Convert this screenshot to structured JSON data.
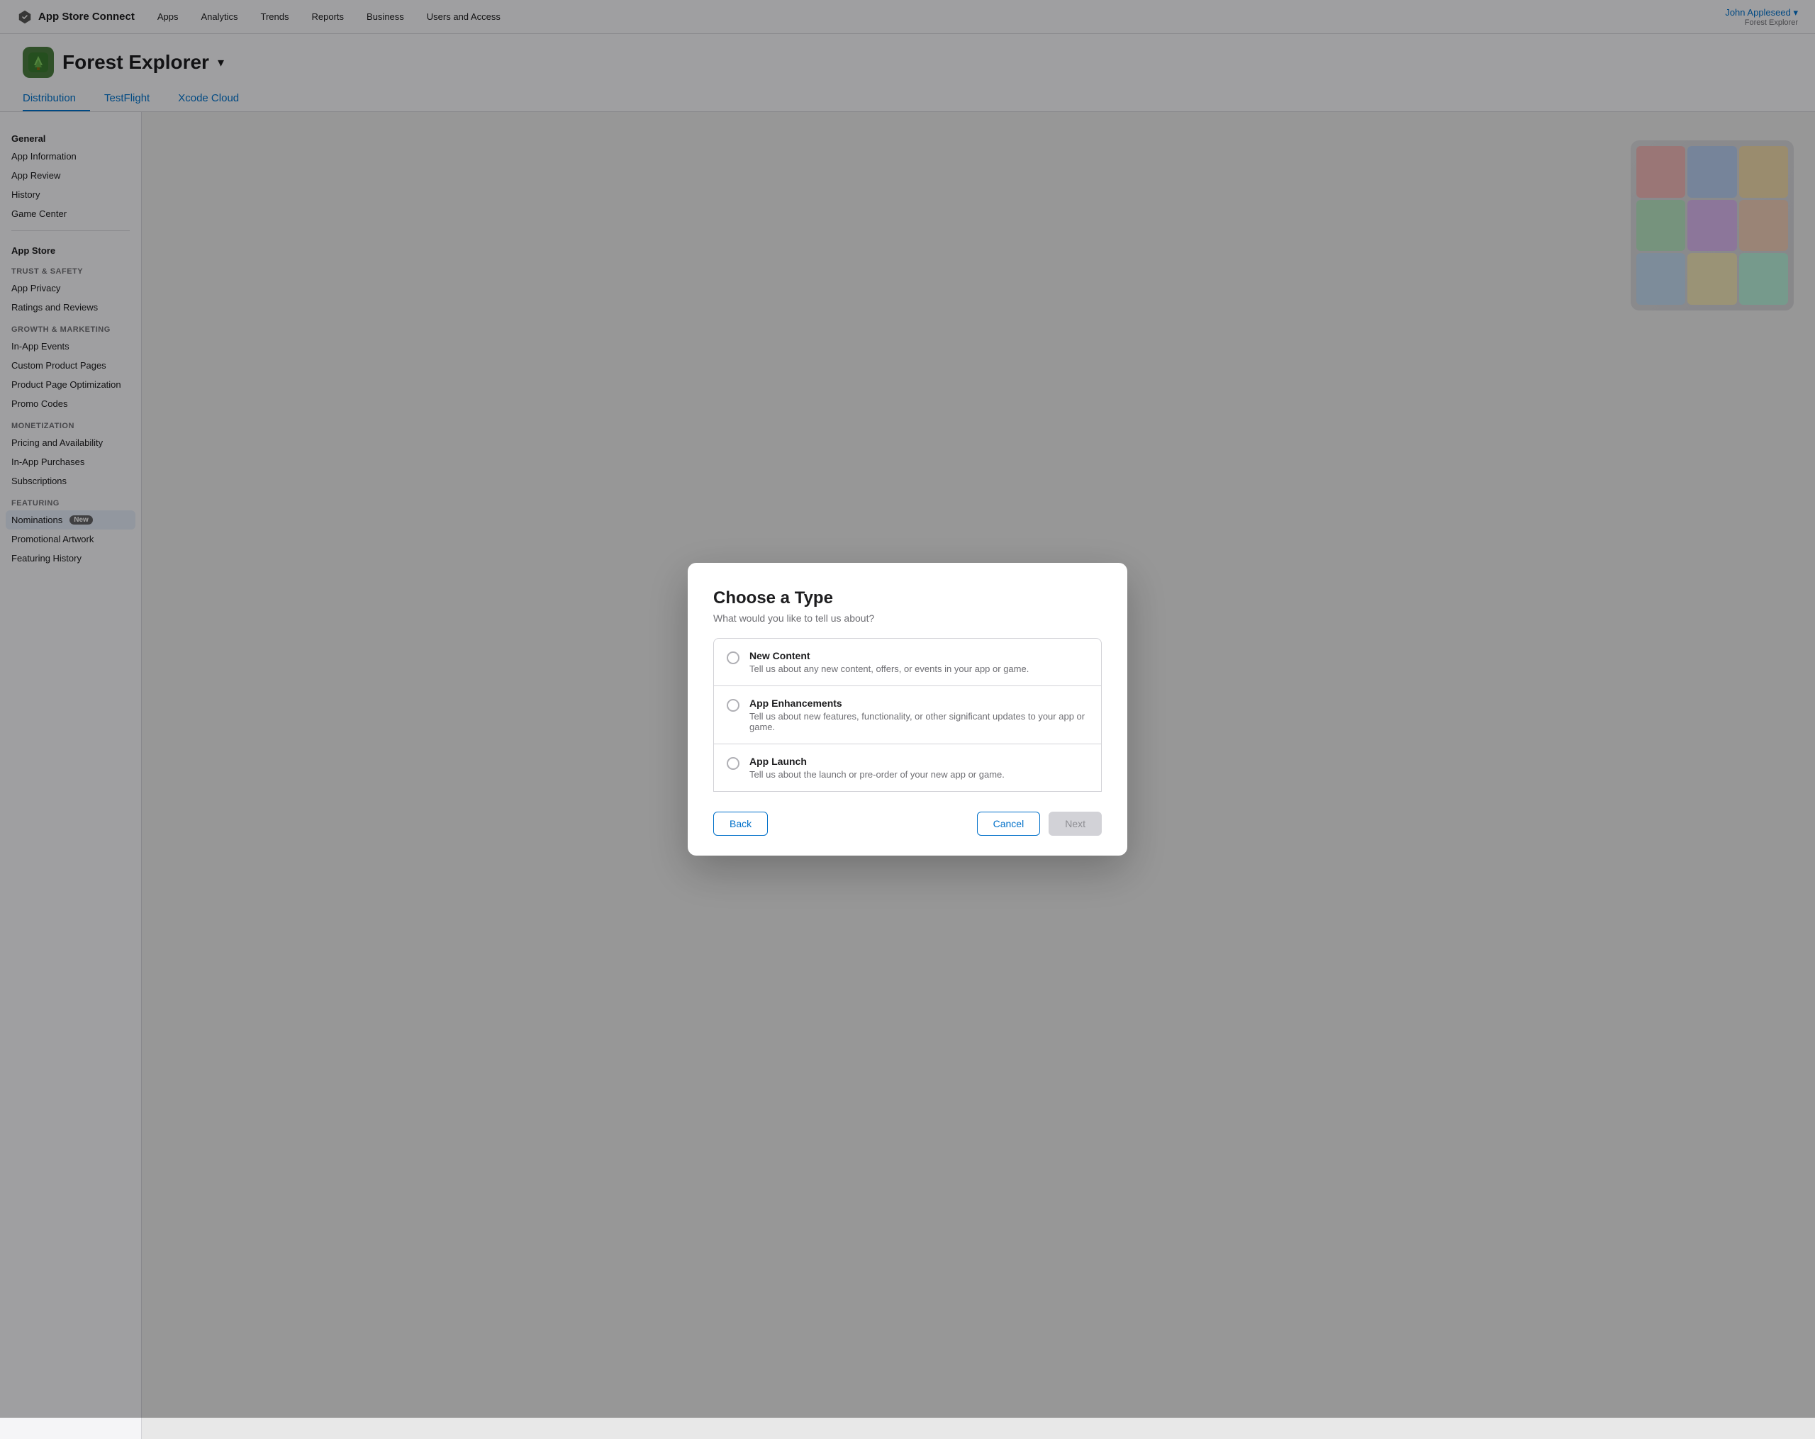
{
  "topnav": {
    "logo_icon": "⚡",
    "brand": "App Store Connect",
    "links": [
      "Apps",
      "Analytics",
      "Trends",
      "Reports",
      "Business",
      "Users and Access"
    ],
    "user_name": "John Appleseed ▾",
    "user_app": "Forest Explorer"
  },
  "app_header": {
    "app_name": "Forest Explorer",
    "dropdown_char": "▾",
    "tabs": [
      {
        "label": "Distribution",
        "active": true
      },
      {
        "label": "TestFlight",
        "active": false
      },
      {
        "label": "Xcode Cloud",
        "active": false
      }
    ]
  },
  "sidebar": {
    "general_title": "General",
    "general_items": [
      {
        "label": "App Information"
      },
      {
        "label": "App Review"
      },
      {
        "label": "History"
      },
      {
        "label": "Game Center"
      }
    ],
    "appstore_title": "App Store",
    "trust_safety_title": "TRUST & SAFETY",
    "trust_items": [
      {
        "label": "App Privacy"
      },
      {
        "label": "Ratings and Reviews"
      }
    ],
    "growth_title": "GROWTH & MARKETING",
    "growth_items": [
      {
        "label": "In-App Events"
      },
      {
        "label": "Custom Product Pages"
      },
      {
        "label": "Product Page Optimization"
      },
      {
        "label": "Promo Codes"
      }
    ],
    "monetization_title": "MONETIZATION",
    "monetization_items": [
      {
        "label": "Pricing and Availability"
      },
      {
        "label": "In-App Purchases"
      },
      {
        "label": "Subscriptions"
      }
    ],
    "featuring_title": "FEATURING",
    "featuring_items": [
      {
        "label": "Nominations",
        "badge": "New",
        "active": true
      },
      {
        "label": "Promotional Artwork"
      },
      {
        "label": "Featuring History"
      }
    ]
  },
  "modal": {
    "title": "Choose a Type",
    "subtitle": "What would you like to tell us about?",
    "options": [
      {
        "title": "New Content",
        "desc": "Tell us about any new content, offers, or events in your app or game.",
        "selected": false
      },
      {
        "title": "App Enhancements",
        "desc": "Tell us about new features, functionality, or other significant updates to your app or game.",
        "selected": false
      },
      {
        "title": "App Launch",
        "desc": "Tell us about the launch or pre-order of your new app or game.",
        "selected": false
      }
    ],
    "back_label": "Back",
    "cancel_label": "Cancel",
    "next_label": "Next"
  }
}
